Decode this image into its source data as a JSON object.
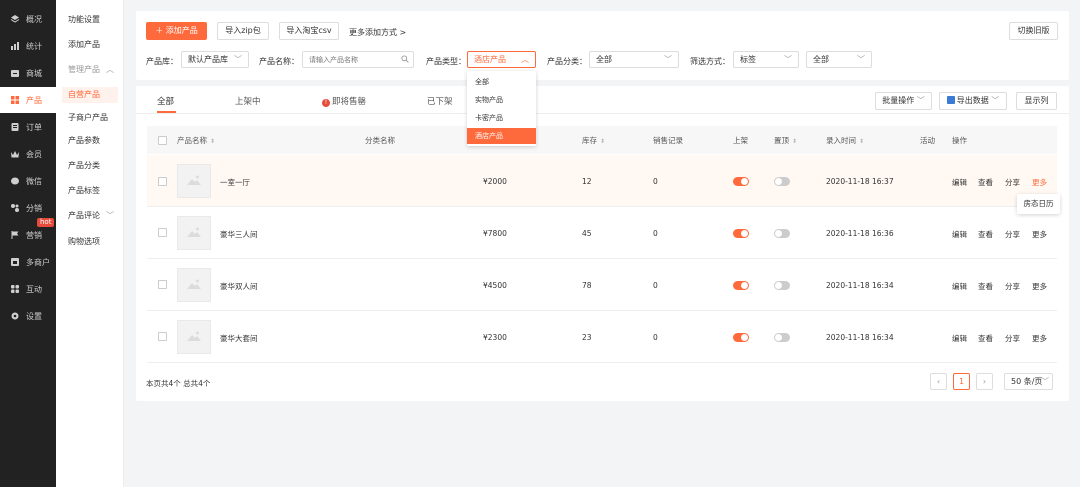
{
  "sidebar": {
    "items": [
      {
        "label": "概况",
        "icon": "layers-icon"
      },
      {
        "label": "统计",
        "icon": "chart-icon"
      },
      {
        "label": "商城",
        "icon": "store-icon"
      },
      {
        "label": "产品",
        "icon": "grid-icon"
      },
      {
        "label": "订单",
        "icon": "order-icon"
      },
      {
        "label": "会员",
        "icon": "crown-icon"
      },
      {
        "label": "微信",
        "icon": "wechat-icon"
      },
      {
        "label": "分销",
        "icon": "share-icon"
      },
      {
        "label": "营销",
        "icon": "flag-icon"
      },
      {
        "label": "多商户",
        "icon": "merchant-icon"
      },
      {
        "label": "互动",
        "icon": "apps-icon"
      },
      {
        "label": "设置",
        "icon": "gear-icon"
      }
    ],
    "hot_badge": "hot"
  },
  "subnav": {
    "items": [
      "功能设置",
      "添加产品",
      "管理产品",
      "自营产品",
      "子商户产品",
      "产品参数",
      "产品分类",
      "产品标签",
      "产品评论",
      "购物选项"
    ]
  },
  "toolbar": {
    "add_label": "添加产品",
    "import_zip": "导入zip包",
    "import_taobao": "导入淘宝csv",
    "more_add": "更多添加方式 >",
    "switch_old": "切换旧版"
  },
  "filters": {
    "library_label": "产品库：",
    "library_value": "默认产品库",
    "name_label": "产品名称：",
    "name_placeholder": "请输入产品名称",
    "type_label": "产品类型：",
    "type_value": "酒店产品",
    "category_label": "产品分类：",
    "category_value": "全部",
    "filter_label": "筛选方式：",
    "filter_value": "标签",
    "filter_value2": "全部"
  },
  "type_dropdown": {
    "options": [
      "全部",
      "实物产品",
      "卡密产品",
      "酒店产品"
    ],
    "selected": "酒店产品"
  },
  "tabs": [
    "全部",
    "上架中",
    "即将售罄",
    "已下架"
  ],
  "actions": {
    "batch": "批量操作",
    "export": "导出数据",
    "columns": "显示列"
  },
  "table": {
    "headers": [
      "产品名称",
      "分类名称",
      "库存",
      "销售记录",
      "上架",
      "置顶",
      "录入时间",
      "活动",
      "操作"
    ],
    "rows": [
      {
        "name": "一室一厅",
        "price": "¥2000",
        "stock": "12",
        "sales": "0",
        "listed": true,
        "pinned": false,
        "time": "2020-11-18 16:37"
      },
      {
        "name": "豪华三人间",
        "price": "¥7800",
        "stock": "45",
        "sales": "0",
        "listed": true,
        "pinned": false,
        "time": "2020-11-18 16:36"
      },
      {
        "name": "豪华双人间",
        "price": "¥4500",
        "stock": "78",
        "sales": "0",
        "listed": true,
        "pinned": false,
        "time": "2020-11-18 16:34"
      },
      {
        "name": "豪华大套间",
        "price": "¥2300",
        "stock": "23",
        "sales": "0",
        "listed": true,
        "pinned": false,
        "time": "2020-11-18 16:34"
      }
    ],
    "row_actions": [
      "编辑",
      "查看",
      "分享",
      "更多"
    ],
    "more_tooltip": "房态日历"
  },
  "footer": {
    "summary": "本页共4个 总共4个",
    "current_page": "1",
    "page_size": "50 条/页"
  },
  "colors": {
    "accent": "#ff6a3c",
    "sidebar_bg": "#222222"
  }
}
